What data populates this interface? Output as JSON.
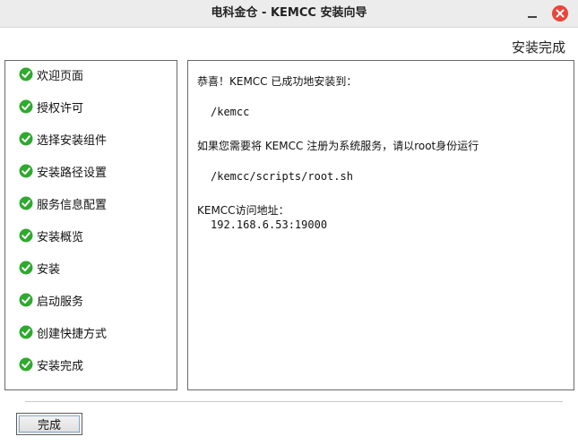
{
  "window": {
    "title": "电科金仓 - KEMCC 安装向导"
  },
  "header": {
    "title": "安装完成"
  },
  "steps": [
    {
      "label": "欢迎页面",
      "status": "done"
    },
    {
      "label": "授权许可",
      "status": "done"
    },
    {
      "label": "选择安装组件",
      "status": "done"
    },
    {
      "label": "安装路径设置",
      "status": "done"
    },
    {
      "label": "服务信息配置",
      "status": "done"
    },
    {
      "label": "安装概览",
      "status": "done"
    },
    {
      "label": "安装",
      "status": "done"
    },
    {
      "label": "启动服务",
      "status": "done"
    },
    {
      "label": "创建快捷方式",
      "status": "done"
    },
    {
      "label": "安装完成",
      "status": "done"
    }
  ],
  "content": {
    "line1": "恭喜！KEMCC 已成功地安装到：",
    "install_path": "/kemcc",
    "line2": "如果您需要将 KEMCC 注册为系统服务，请以root身份运行",
    "script_path": "/kemcc/scripts/root.sh",
    "access_label": "KEMCC访问地址：",
    "access_address": "192.168.6.53:19000"
  },
  "footer": {
    "finish_label": "完成"
  },
  "colors": {
    "check_green": "#2eaa2e",
    "close_red": "#e8463b"
  }
}
